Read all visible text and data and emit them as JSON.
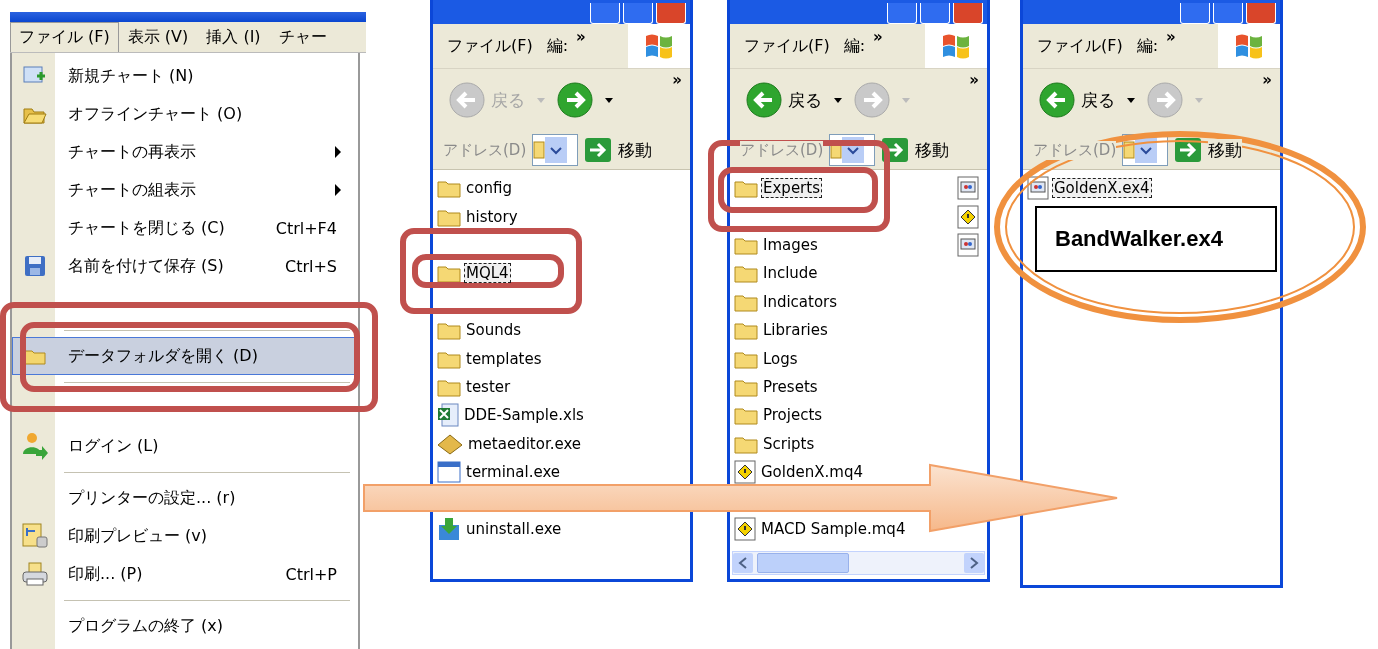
{
  "menu_window": {
    "menubar": [
      {
        "label": "ファイル (F)",
        "selected": true
      },
      {
        "label": "表示 (V)",
        "selected": false
      },
      {
        "label": "挿入 (I)",
        "selected": false
      },
      {
        "label": "チャー",
        "selected": false
      }
    ],
    "items": [
      {
        "kind": "item",
        "label": "新規チャート (N)",
        "submenu": false,
        "selected": false
      },
      {
        "kind": "item",
        "label": "オフラインチャート (O)",
        "submenu": false,
        "selected": false
      },
      {
        "kind": "item",
        "label": "チャートの再表示",
        "submenu": true,
        "selected": false
      },
      {
        "kind": "item",
        "label": "チャートの組表示",
        "submenu": true,
        "selected": false
      },
      {
        "kind": "item",
        "label": "チャートを閉じる (C)",
        "shortcut": "Ctrl+F4",
        "submenu": false,
        "selected": false
      },
      {
        "kind": "item",
        "label": "名前を付けて保存 (S)",
        "shortcut": "Ctrl+S",
        "submenu": false,
        "selected": false
      },
      {
        "kind": "item"
      },
      {
        "kind": "separator"
      },
      {
        "kind": "item",
        "label": "データフォルダを開く (D)",
        "submenu": false,
        "selected": true
      },
      {
        "kind": "separator"
      },
      {
        "kind": "item"
      },
      {
        "kind": "item",
        "label": "ログイン (L)",
        "submenu": false,
        "selected": false
      },
      {
        "kind": "separator"
      },
      {
        "kind": "item",
        "label": "プリンターの設定... (r)",
        "submenu": false,
        "selected": false
      },
      {
        "kind": "item",
        "label": "印刷プレビュー (v)",
        "submenu": false,
        "selected": false
      },
      {
        "kind": "item",
        "label": "印刷... (P)",
        "shortcut": "Ctrl+P",
        "submenu": false,
        "selected": false
      },
      {
        "kind": "separator"
      },
      {
        "kind": "item",
        "label": "プログラムの終了 (x)",
        "submenu": false,
        "selected": false
      }
    ]
  },
  "explorers": [
    {
      "menu": [
        "ファイル(F)",
        "編:"
      ],
      "menu_overflow": "»",
      "back": {
        "label": "戻る",
        "disabled": true
      },
      "forward": {
        "disabled": false
      },
      "toolbar_overflow": "»",
      "address_label": "アドレス(D)",
      "go_label": "移動",
      "horizontal_scrollbar": false,
      "files": [
        {
          "kind": "folder",
          "name": "config",
          "focused": false
        },
        {
          "kind": "folder",
          "name": "history",
          "focused": false
        },
        {
          "kind": "blank"
        },
        {
          "kind": "folder",
          "name": "MQL4",
          "focused": true
        },
        {
          "kind": "blank"
        },
        {
          "kind": "folder",
          "name": "Sounds",
          "focused": false
        },
        {
          "kind": "folder",
          "name": "templates",
          "focused": false
        },
        {
          "kind": "folder",
          "name": "tester",
          "focused": false
        },
        {
          "kind": "excel",
          "name": "DDE-Sample.xls",
          "focused": false
        },
        {
          "kind": "editor",
          "name": "metaeditor.exe",
          "focused": false
        },
        {
          "kind": "exe",
          "name": "terminal.exe",
          "focused": false
        },
        {
          "kind": "blank"
        },
        {
          "kind": "installer",
          "name": "uninstall.exe",
          "focused": false
        }
      ]
    },
    {
      "menu": [
        "ファイル(F)",
        "編:"
      ],
      "menu_overflow": "»",
      "back": {
        "label": "戻る",
        "disabled": false
      },
      "forward": {
        "disabled": true
      },
      "toolbar_overflow": "»",
      "address_label": "アドレス(D)",
      "go_label": "移動",
      "horizontal_scrollbar": true,
      "side_icons": [
        {
          "kind": "ex4"
        },
        {
          "kind": "mq4"
        },
        {
          "kind": "ex4"
        }
      ],
      "files": [
        {
          "kind": "folder",
          "name": "Experts",
          "focused": true
        },
        {
          "kind": "blank"
        },
        {
          "kind": "folder",
          "name": "Images",
          "focused": false
        },
        {
          "kind": "folder",
          "name": "Include",
          "focused": false
        },
        {
          "kind": "folder",
          "name": "Indicators",
          "focused": false
        },
        {
          "kind": "folder",
          "name": "Libraries",
          "focused": false
        },
        {
          "kind": "folder",
          "name": "Logs",
          "focused": false
        },
        {
          "kind": "folder",
          "name": "Presets",
          "focused": false
        },
        {
          "kind": "folder",
          "name": "Projects",
          "focused": false
        },
        {
          "kind": "folder",
          "name": "Scripts",
          "focused": false
        },
        {
          "kind": "mq4",
          "name": "GoldenX.mq4",
          "focused": false
        },
        {
          "kind": "blank"
        },
        {
          "kind": "mq4",
          "name": "MACD Sample.mq4",
          "focused": false
        }
      ]
    },
    {
      "menu": [
        "ファイル(F)",
        "編:"
      ],
      "menu_overflow": "»",
      "back": {
        "label": "戻る",
        "disabled": false
      },
      "forward": {
        "disabled": true
      },
      "toolbar_overflow": "»",
      "address_label": "アドレス(D)",
      "go_label": "移動",
      "horizontal_scrollbar": false,
      "files": [
        {
          "kind": "ex4",
          "name": "GoldenX.ex4",
          "focused": true
        }
      ],
      "callout": "BandWalker.ex4"
    }
  ]
}
